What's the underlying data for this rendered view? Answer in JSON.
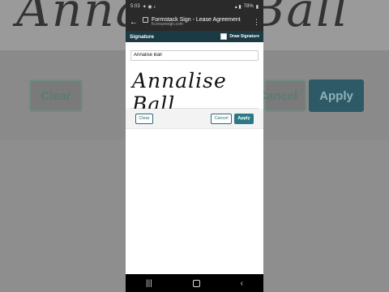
{
  "background": {
    "signature_ghost": "Annalise Ball",
    "clear_label": "Clear",
    "cancel_label": "Cancel",
    "apply_label": "Apply"
  },
  "status_bar": {
    "time": "5:03",
    "battery": "78%"
  },
  "browser": {
    "title": "Formstack Sign - Lease Agreement",
    "url": "fs.insurexign.com"
  },
  "signature_panel": {
    "heading": "Signature",
    "draw_label": "Draw Signature",
    "name_value": "Annalise Ball",
    "rendered_signature": "Annalise Ball"
  },
  "actions": {
    "clear": "Clear",
    "cancel": "Cancel",
    "apply": "Apply"
  },
  "colors": {
    "header_bg": "#1b3a44",
    "accent": "#2a7a86"
  }
}
